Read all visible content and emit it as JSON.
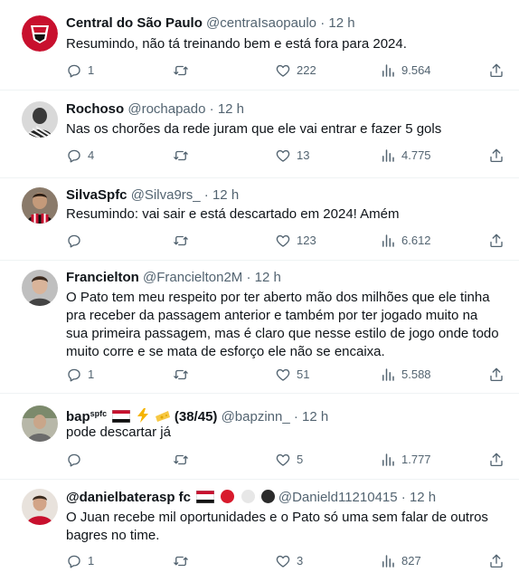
{
  "tweets": [
    {
      "name": "Central do São Paulo",
      "handle": "@centraIsaopaulo",
      "time": "12 h",
      "text": "Resumindo, não tá treinando bem e está fora para 2024.",
      "replies": "1",
      "retweets": "",
      "likes": "222",
      "views": "9.564"
    },
    {
      "name": "Rochoso",
      "handle": "@rochapado",
      "time": "12 h",
      "text": "Nas os chorões da rede juram que ele vai entrar e fazer 5 gols",
      "replies": "4",
      "retweets": "",
      "likes": "13",
      "views": "4.775"
    },
    {
      "name": "SilvaSpfc",
      "handle": "@Silva9rs_",
      "time": "12 h",
      "text": "Resumindo: vai sair e está descartado em 2024! Amém",
      "replies": "",
      "retweets": "",
      "likes": "123",
      "views": "6.612"
    },
    {
      "name": "Francielton",
      "handle": "@Francielton2M",
      "time": "12 h",
      "text": "O Pato tem meu respeito por ter aberto mão dos milhões que ele tinha pra receber da passagem anterior e também por ter jogado muito na sua primeira passagem, mas é claro que nesse estilo de jogo onde todo muito corre e se mata de esforço ele não se encaixa.",
      "replies": "1",
      "retweets": "",
      "likes": "51",
      "views": "5.588"
    },
    {
      "name": "bap",
      "name_sup": "spfc",
      "name_suffix": "(38/45)",
      "handle": "@bapzinn_",
      "time": "12 h",
      "text": "pode descartar já",
      "replies": "",
      "retweets": "",
      "likes": "5",
      "views": "1.777"
    },
    {
      "name": "@danielbaterasp fc",
      "handle": "@Danield11210415",
      "time": "12 h",
      "text": "O Juan recebe mil oportunidades e o Pato só uma sem falar de outros bagres no time.",
      "replies": "1",
      "retweets": "",
      "likes": "3",
      "views": "827"
    }
  ],
  "separator": "·",
  "colors": {
    "text": "#0f1419",
    "muted": "#536471",
    "border": "#eff3f4",
    "spfc_red": "#c8102e"
  }
}
